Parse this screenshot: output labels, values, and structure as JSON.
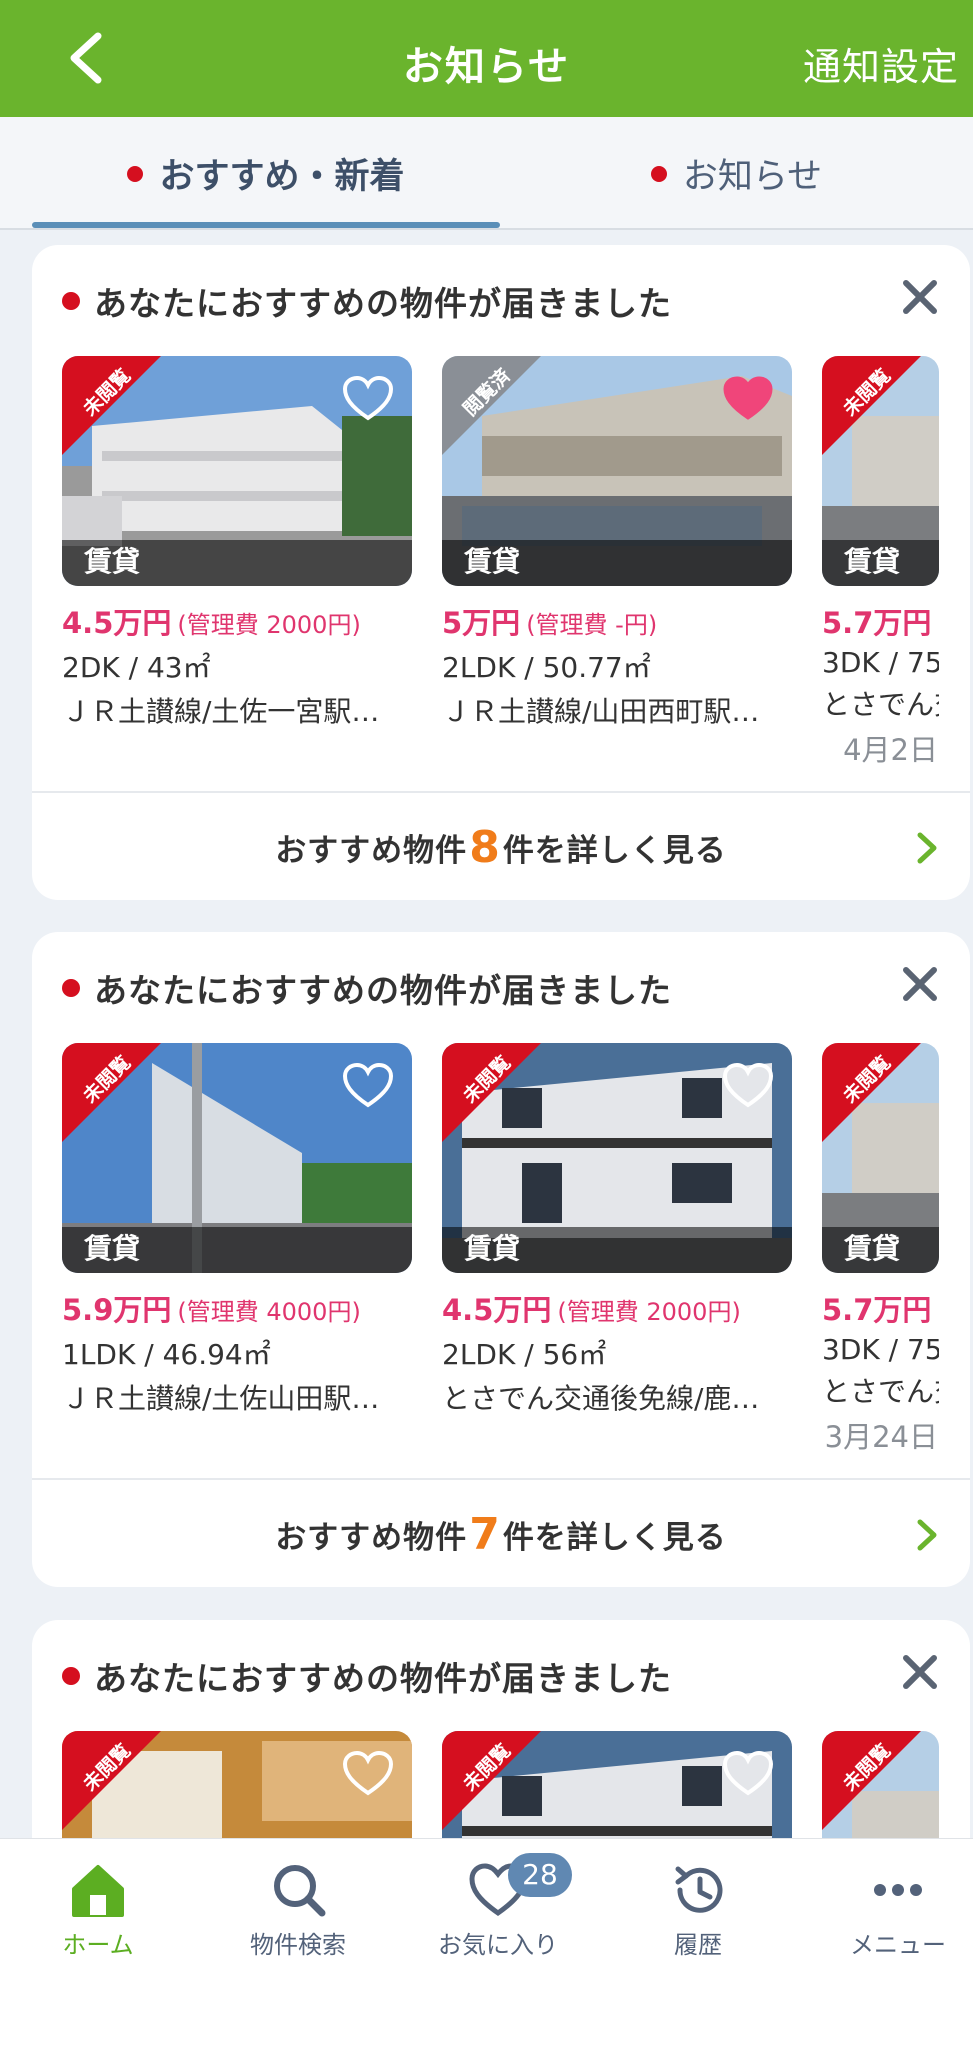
{
  "header": {
    "title": "お知らせ",
    "settings_label": "通知設定"
  },
  "tabs": [
    {
      "label": "おすすめ・新着"
    },
    {
      "label": "お知らせ"
    }
  ],
  "cards": [
    {
      "title": "あなたにおすすめの物件が届きました",
      "date": "4月2日",
      "more_prefix": "おすすめ物件",
      "more_count": "8",
      "more_suffix": "件を詳しく見る",
      "properties": [
        {
          "badge": "未閲覧",
          "type": "賃貸",
          "rent": "4.5万円",
          "fee": "(管理費 2000円)",
          "layout": "2DK / 43㎡",
          "access": "ＪＲ土讃線/土佐一宮駅…",
          "favorited": false
        },
        {
          "badge": "閲覧済",
          "type": "賃貸",
          "rent": "5万円",
          "fee": "(管理費 -円)",
          "layout": "2LDK / 50.77㎡",
          "access": "ＪＲ土讃線/山田西町駅…",
          "favorited": true
        },
        {
          "badge": "未閲覧",
          "type": "賃貸",
          "rent": "5.7万円",
          "fee": "",
          "layout": "3DK / 75",
          "access": "とさでん交",
          "favorited": false
        }
      ]
    },
    {
      "title": "あなたにおすすめの物件が届きました",
      "date": "3月24日",
      "more_prefix": "おすすめ物件",
      "more_count": "7",
      "more_suffix": "件を詳しく見る",
      "properties": [
        {
          "badge": "未閲覧",
          "type": "賃貸",
          "rent": "5.9万円",
          "fee": "(管理費 4000円)",
          "layout": "1LDK / 46.94㎡",
          "access": "ＪＲ土讃線/土佐山田駅…",
          "favorited": false
        },
        {
          "badge": "未閲覧",
          "type": "賃貸",
          "rent": "4.5万円",
          "fee": "(管理費 2000円)",
          "layout": "2LDK / 56㎡",
          "access": "とさでん交通後免線/鹿…",
          "favorited": false
        },
        {
          "badge": "未閲覧",
          "type": "賃貸",
          "rent": "5.7万円",
          "fee": "",
          "layout": "3DK / 75",
          "access": "とさでん交",
          "favorited": false
        }
      ]
    },
    {
      "title": "あなたにおすすめの物件が届きました",
      "properties": [
        {
          "badge": "未閲覧"
        },
        {
          "badge": "未閲覧"
        },
        {
          "badge": "未閲覧"
        }
      ]
    }
  ],
  "bottom_nav": [
    {
      "label": "ホーム",
      "icon": "home-icon",
      "active": true
    },
    {
      "label": "物件検索",
      "icon": "search-icon"
    },
    {
      "label": "お気に入り",
      "icon": "heart-icon",
      "badge": "28"
    },
    {
      "label": "履歴",
      "icon": "history-icon"
    },
    {
      "label": "メニュー",
      "icon": "more-icon"
    }
  ],
  "colors": {
    "brand_green": "#6ab42d",
    "price_pink": "#e0356e",
    "accent_orange": "#f07c1a",
    "unread_red": "#d50f1f"
  }
}
